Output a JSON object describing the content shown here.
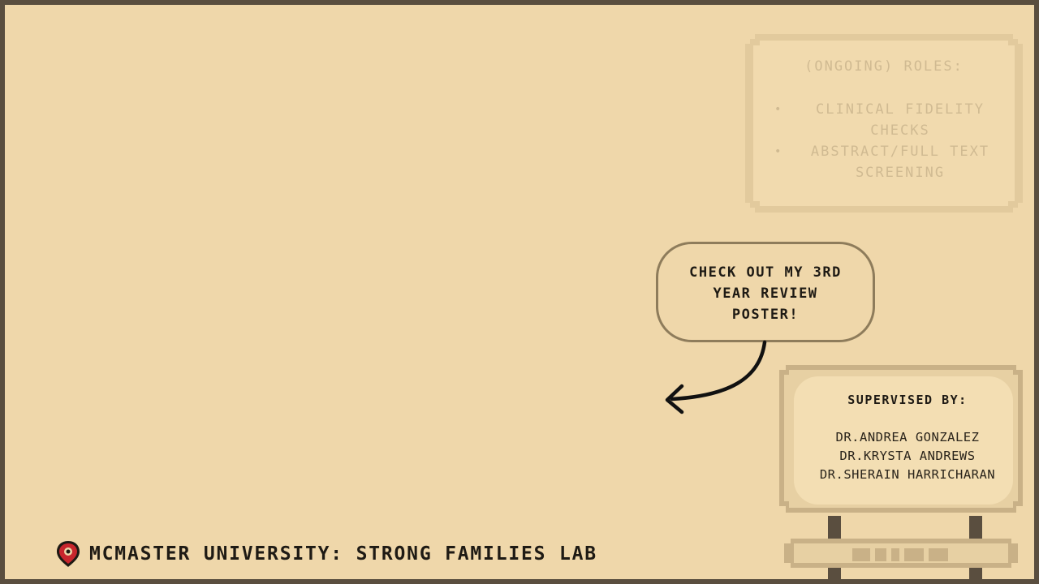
{
  "roles": {
    "title": "(ONGOING) ROLES:",
    "items": [
      {
        "line1": "CLINICAL FIDELITY",
        "line2": "CHECKS"
      },
      {
        "line1": "ABSTRACT/FULL TEXT",
        "line2": "SCREENING"
      }
    ]
  },
  "callout": {
    "line1": "CHECK OUT MY 3RD",
    "line2": "YEAR REVIEW",
    "line3": "POSTER!"
  },
  "supervisors": {
    "title": "SUPERVISED BY:",
    "names": [
      "DR.ANDREA GONZALEZ",
      "DR.KRYSTA ANDREWS",
      "DR.SHERAIN HARRICHARAN"
    ]
  },
  "footer": {
    "icon": "map-pin-icon",
    "text": "MCMASTER UNIVERSITY: STRONG FAMILIES LAB"
  },
  "colors": {
    "background": "#efd7aa",
    "frame": "#5a4e3f",
    "panel": "#f3deb3",
    "panel_border": "#d8c094",
    "ink": "#1e1a14",
    "accent_red": "#c8262d"
  }
}
